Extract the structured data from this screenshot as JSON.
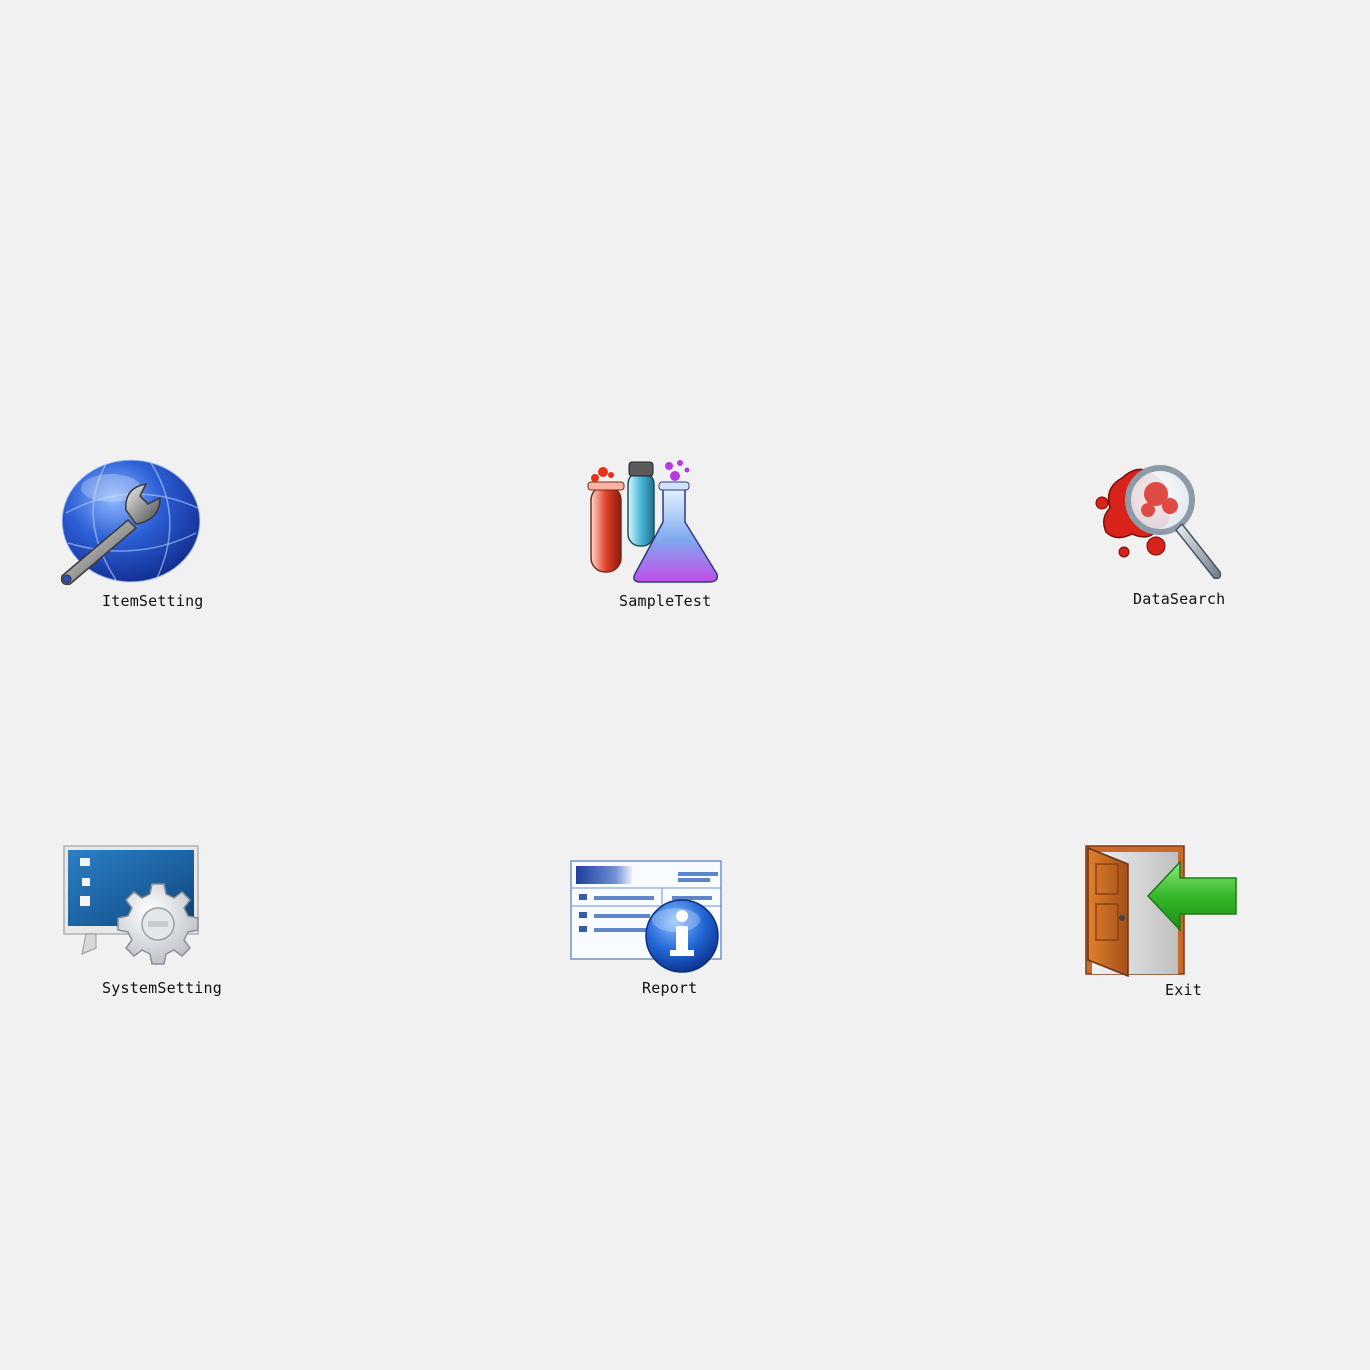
{
  "desktop": {
    "background": "#f1f1f1",
    "items": [
      {
        "id": "item-setting",
        "label": "ItemSetting",
        "icon": "globe-wrench-icon"
      },
      {
        "id": "sample-test",
        "label": "SampleTest",
        "icon": "test-tubes-flask-icon"
      },
      {
        "id": "data-search",
        "label": "DataSearch",
        "icon": "blood-magnifier-icon"
      },
      {
        "id": "system-setting",
        "label": "SystemSetting",
        "icon": "monitor-gear-icon"
      },
      {
        "id": "report",
        "label": "Report",
        "icon": "report-info-icon"
      },
      {
        "id": "exit",
        "label": "Exit",
        "icon": "door-arrow-icon"
      }
    ]
  }
}
